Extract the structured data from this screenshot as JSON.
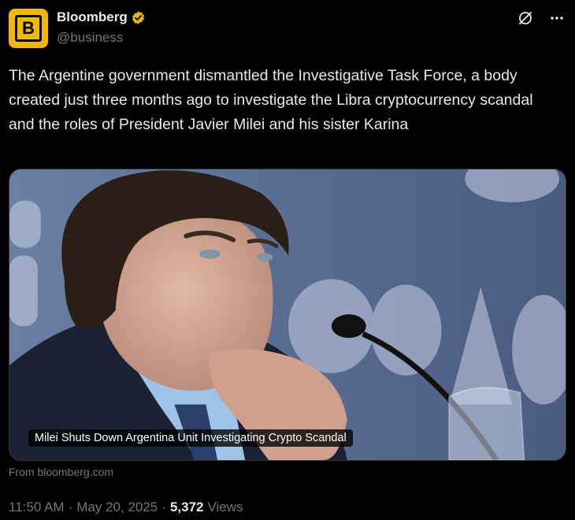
{
  "author": {
    "display_name": "Bloomberg",
    "handle": "@business",
    "avatar_letter": "B",
    "avatar_color": "#f2b705",
    "verified_badge_color": "#e2b719"
  },
  "icons": {
    "grok": "grok-icon",
    "more": "more-icon",
    "verified": "verified-badge-icon"
  },
  "tweet": {
    "text": "The Argentine government dismantled the Investigative Task Force, a body created just three months ago to investigate the Libra cryptocurrency scandal and the roles of President Javier Milei and his sister Karina"
  },
  "card": {
    "headline": "Milei Shuts Down Argentina Unit Investigating Crypto Scandal",
    "source": "From bloomberg.com"
  },
  "meta": {
    "time": "11:50 AM",
    "separator": "·",
    "date": "May 20, 2025",
    "views_count": "5,372",
    "views_label": "Views"
  }
}
